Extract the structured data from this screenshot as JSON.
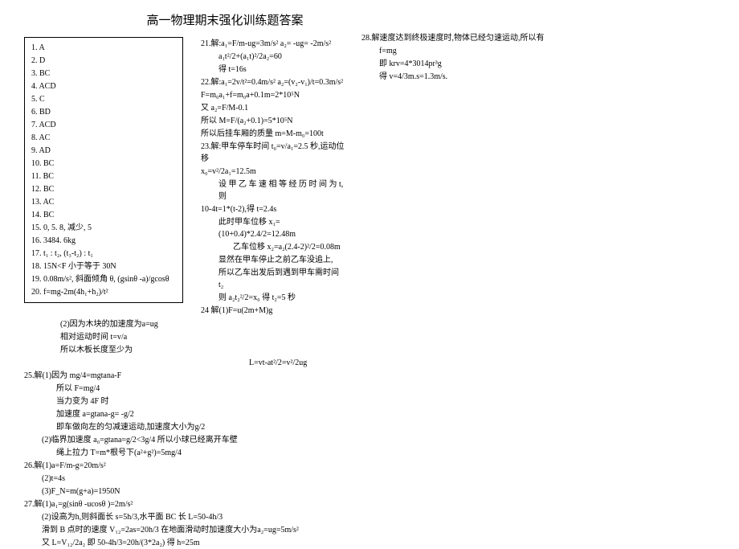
{
  "title": "高一物理期末强化训练题答案",
  "answers": {
    "a1": "1. A",
    "a2": "2. D",
    "a3": "3. BC",
    "a4": "4. ACD",
    "a5": "5. C",
    "a6": "6. BD",
    "a7": "7. ACD",
    "a8": "8. AC",
    "a9": "9. AD",
    "a10": "10. BC",
    "a11": "11. BC",
    "a12": "12. BC",
    "a13": "13. AC",
    "a14": "14. BC",
    "a15": "15. 0, 5. 8, 减少, 5",
    "a16": "16. 3484. 6kg",
    "a17": "17. t₁ : t₂, (t₃-t₂) : t₁",
    "a18": "18. 15N<F 小于等于 30N",
    "a19": "19. 0.08m/s², 斜面倾角 θ, (gsinθ -a)/gcosθ",
    "a20": "20. f=mg-2m(4h₁+h₂)/t²"
  },
  "mid": {
    "l1": "21.解:a₁=F/m-ug=3m/s²    a₂= -ug= -2m/s²",
    "l2": "a₁t²/2+(a₁t)²/2a₂=60",
    "l3": "得 t=16s",
    "l4": "22.解:a₁=2v/t²=0.4m/s²   a₂=(v₂-v₁)/t=0.3m/s²",
    "l5": "F=m₀a₁+f=m₀a+0.1m=2*10⁵N",
    "l6": "又 a₂=F/M-0.1",
    "l7": "所以 M=F/(a₂+0.1)=5*10⁵N",
    "l8": "所以后挂车厢的质量 m=M-m₀=100t",
    "l9": "23.解:甲车停车时间  t₀=v/a₁=2.5 秒,运动位移",
    "l10": "x₀=v²/2a₁=12.5m",
    "l11": "设 甲 乙 车 速 相 等 经 历 时 间 为 t, 则",
    "l12": "10-4t=1*(t-2),得 t=2.4s",
    "l13": "此时甲车位移 x₁=(10+0.4)*2.4/2=12.48m",
    "l14": "乙车位移 x₂=a₂(2.4-2)²/2=0.08m",
    "l15": "显然在甲车停止之前乙车没追上,",
    "l16": "所以乙车出发后到遇到甲车需时间 t₂",
    "l17": "则 a₂t₂²/2=x₀   得 t₂=5 秒",
    "l18": "24 解(1)F=u(2m+M)g"
  },
  "right": {
    "l1": "28.解速度达到终极速度时,物体已经匀速运动,所以有",
    "l2": "f=mg",
    "l3": "即 krv=4*3014pr³g",
    "l4": "得 v=4/3m.s=1.3m/s."
  },
  "bottom": {
    "b1": "(2)因为木块的加速度为a=ug",
    "b2": "相对运动时间 t=v/a",
    "b3": "所以木板长度至少为",
    "b4": "L=vt-at²/2=v²/2ug",
    "b5": "25.解(1)因为 mg/4=mgtana-F",
    "b6": "所以 F=mg/4",
    "b7": "当力变为 4F 时",
    "b8": "加速度 a=gtana-g= -g/2",
    "b9": "即车做向左的匀减速运动,加速度大小为g/2",
    "b10": "(2)临界加速度 a₀=gtana=g/2<3g/4 所以小球已经离开车壁",
    "b11": "绳上拉力 T=m*根号下(a²+g²)=5mg/4",
    "b12": "26.解(1)a=F/m-g=20m/s²",
    "b13": "(2)t=4s",
    "b14": "(3)F_N=m(g+a)=1950N",
    "b15": "27.解(1)a₁=g(sinθ -ucosθ )=2m/s²",
    "b16": "(2)设高为h,则斜面长 s=5h/3,水平面 BC 长 L=50-4h/3",
    "b17": "滑到 B 点时的速度 V₁₂=2as=20h/3    在地面滑动时加速度大小为a₂=ug=5m/s²",
    "b18": "又 L=V₁₂/2a₂   即 50-4h/3=20h/(3*2a₂)   得 h=25m"
  }
}
